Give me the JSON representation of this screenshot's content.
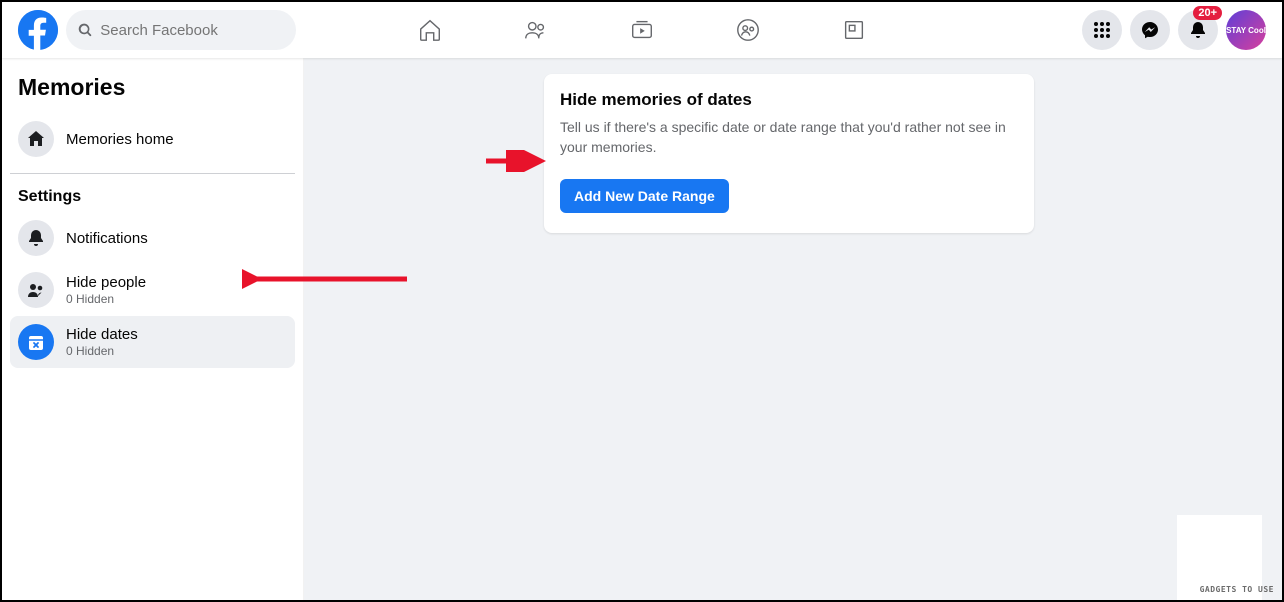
{
  "header": {
    "search_placeholder": "Search Facebook",
    "badge_count": "20+",
    "avatar_text": "STAY Cool"
  },
  "sidebar": {
    "title": "Memories",
    "memories_home": "Memories home",
    "settings_label": "Settings",
    "notifications": "Notifications",
    "hide_people": {
      "label": "Hide people",
      "sub": "0 Hidden"
    },
    "hide_dates": {
      "label": "Hide dates",
      "sub": "0 Hidden"
    }
  },
  "card": {
    "title": "Hide memories of dates",
    "desc": "Tell us if there's a specific date or date range that you'd rather not see in your memories.",
    "button": "Add New Date Range"
  },
  "watermark": "GADGETS TO USE"
}
